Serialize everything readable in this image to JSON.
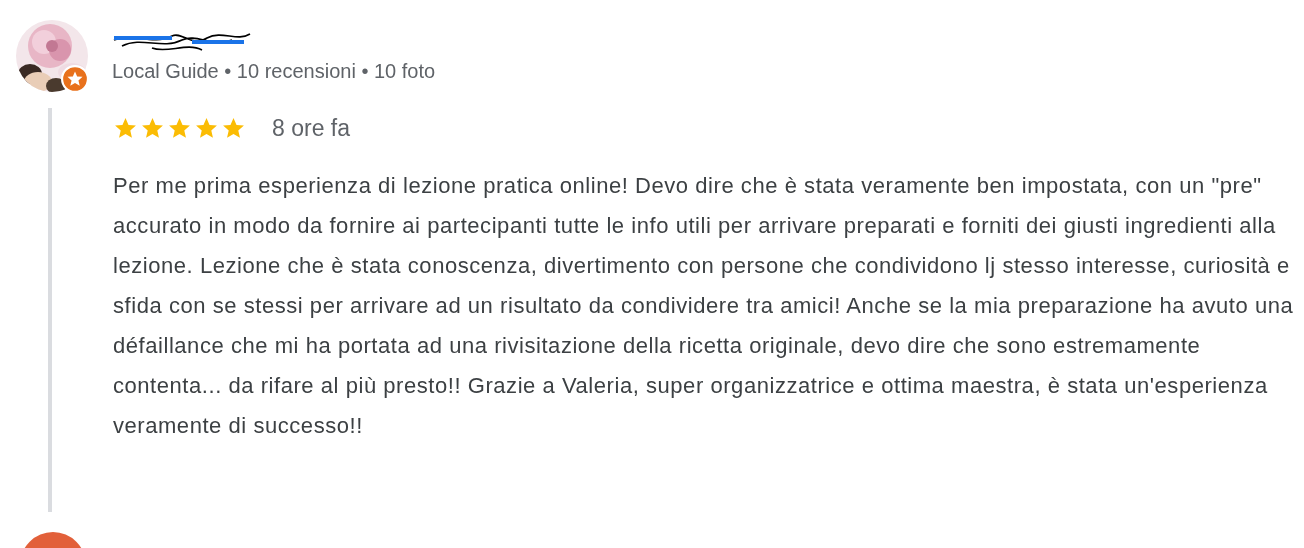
{
  "reviews": [
    {
      "meta": "Local Guide • 10 recensioni • 10 foto",
      "local_guide": true,
      "stars": 5,
      "time": "8 ore fa",
      "text": "Per me prima esperienza di lezione pratica online! Devo dire che è stata veramente ben impostata, con un \"pre\" accurato in modo da fornire ai partecipanti tutte le info utili per arrivare preparati e forniti dei giusti ingredienti alla lezione. Lezione che è stata conoscenza, divertimento con persone che condividono lj stesso interesse, curiosità e sfida con se stessi per arrivare ad un risultato da condividere tra amici! Anche se la mia preparazione ha avuto una défaillance che mi ha portata ad una rivisitazione della ricetta originale, devo dire che sono estremamente contenta... da rifare al più presto!! Grazie a Valeria, super organizzatrice e ottima maestra, è stata un'esperienza veramente di successo!!"
    }
  ]
}
